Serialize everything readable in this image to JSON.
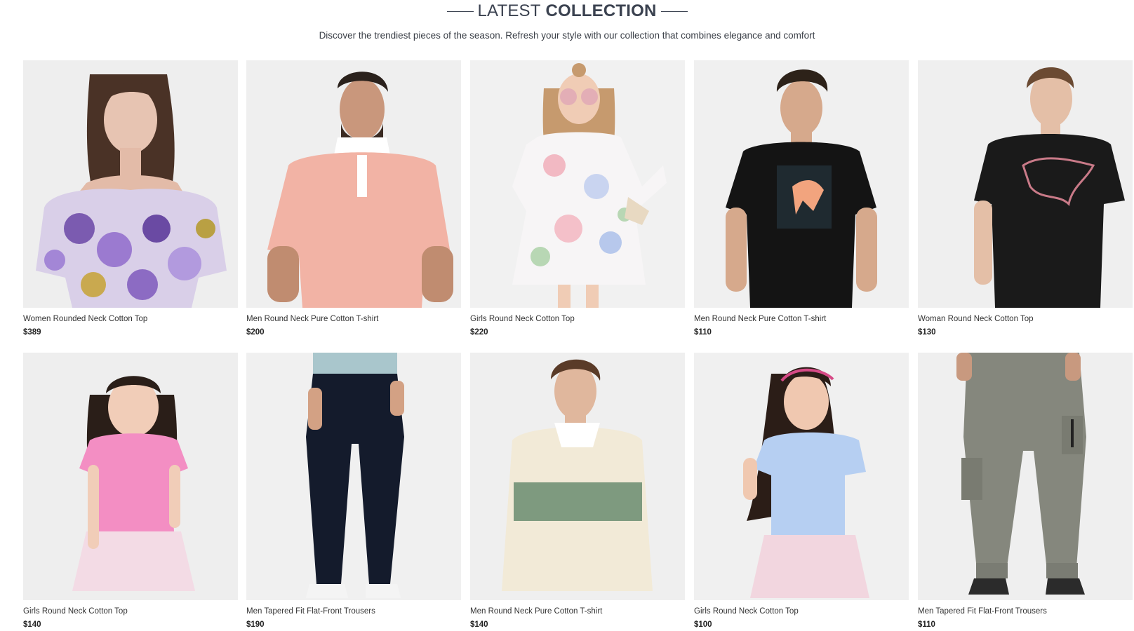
{
  "section": {
    "title_light": "LATEST",
    "title_bold": "COLLECTION",
    "subtitle": "Discover the trendiest pieces of the season. Refresh your style with our collection that combines elegance and comfort"
  },
  "products": [
    {
      "name": "Women Rounded Neck Cotton Top",
      "price": "$389",
      "image": "woman-floral-off-shoulder-top"
    },
    {
      "name": "Men Round Neck Pure Cotton T-shirt",
      "price": "$200",
      "image": "man-pink-polo"
    },
    {
      "name": "Girls Round Neck Cotton Top",
      "price": "$220",
      "image": "girl-floral-dress"
    },
    {
      "name": "Men Round Neck Pure Cotton T-shirt",
      "price": "$110",
      "image": "man-black-tshirt"
    },
    {
      "name": "Woman Round Neck Cotton Top",
      "price": "$130",
      "image": "woman-black-tshirt"
    },
    {
      "name": "Girls Round Neck Cotton Top",
      "price": "$140",
      "image": "girl-pink-top"
    },
    {
      "name": "Men Tapered Fit Flat-Front Trousers",
      "price": "$190",
      "image": "man-navy-trousers"
    },
    {
      "name": "Men Round Neck Pure Cotton T-shirt",
      "price": "$140",
      "image": "man-cream-striped-rugby"
    },
    {
      "name": "Girls Round Neck Cotton Top",
      "price": "$100",
      "image": "girl-blue-top"
    },
    {
      "name": "Men Tapered Fit Flat-Front Trousers",
      "price": "$110",
      "image": "man-grey-cargo-joggers"
    }
  ],
  "colors": {
    "title": "#3b4250",
    "image_bg": "#efefef"
  }
}
